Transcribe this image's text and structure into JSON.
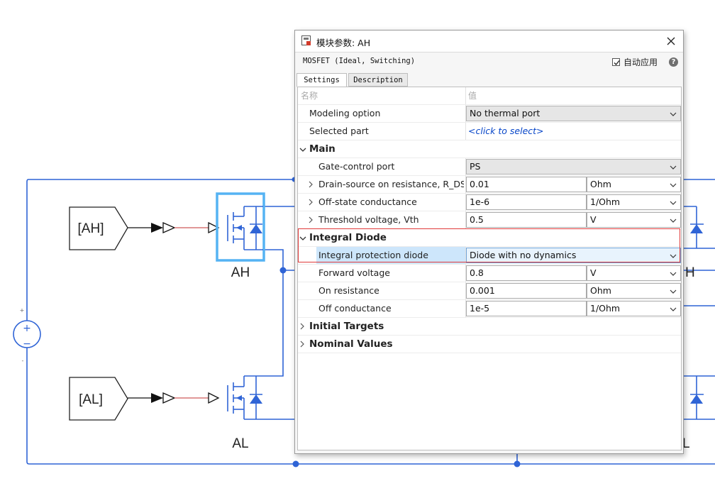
{
  "diagram": {
    "goto_blocks": [
      {
        "tag": "[AH]"
      },
      {
        "tag": "[AL]"
      }
    ],
    "block_labels": {
      "high_switch": "AH",
      "low_switch": "AL",
      "partial_right_top": "H",
      "partial_right_bottom": "L"
    },
    "source_signs": {
      "plus": "+",
      "minus": "−",
      "top_mark": "+",
      "bottom_mark": "-"
    },
    "colors": {
      "wire": "#2f64d6",
      "signal": "#c03030",
      "highlight": "#55b3f3",
      "block": "#3c5fd0"
    }
  },
  "dialog": {
    "title": "模块参数: AH",
    "block_type": "MOSFET (Ideal, Switching)",
    "auto_apply_label": "自动应用",
    "auto_apply_checked": true,
    "help_label": "?",
    "tabs": {
      "settings": "Settings",
      "description": "Description"
    },
    "table_header": {
      "name": "名称",
      "value": "值"
    },
    "modeling_option": {
      "label": "Modeling option",
      "value": "No thermal port"
    },
    "selected_part": {
      "label": "Selected part",
      "value": "<click to select>"
    },
    "main": {
      "title": "Main",
      "gate_control_port": {
        "label": "Gate-control port",
        "value": "PS"
      },
      "drain_source_resistance": {
        "label": "Drain-source on resistance, R_DS...",
        "value": "0.01",
        "unit": "Ohm"
      },
      "off_state_conductance": {
        "label": "Off-state conductance",
        "value": "1e-6",
        "unit": "1/Ohm"
      },
      "threshold_voltage": {
        "label": "Threshold voltage, Vth",
        "value": "0.5",
        "unit": "V"
      }
    },
    "integral_diode": {
      "title": "Integral Diode",
      "protection_diode": {
        "label": "Integral protection diode",
        "value": "Diode with no dynamics"
      },
      "forward_voltage": {
        "label": "Forward voltage",
        "value": "0.8",
        "unit": "V"
      },
      "on_resistance": {
        "label": "On resistance",
        "value": "0.001",
        "unit": "Ohm"
      },
      "off_conductance": {
        "label": "Off conductance",
        "value": "1e-5",
        "unit": "1/Ohm"
      }
    },
    "initial_targets": {
      "title": "Initial Targets"
    },
    "nominal_values": {
      "title": "Nominal Values"
    },
    "colors": {
      "highlight_border": "#e03a3a",
      "selected_row": "#cde6fb"
    }
  }
}
